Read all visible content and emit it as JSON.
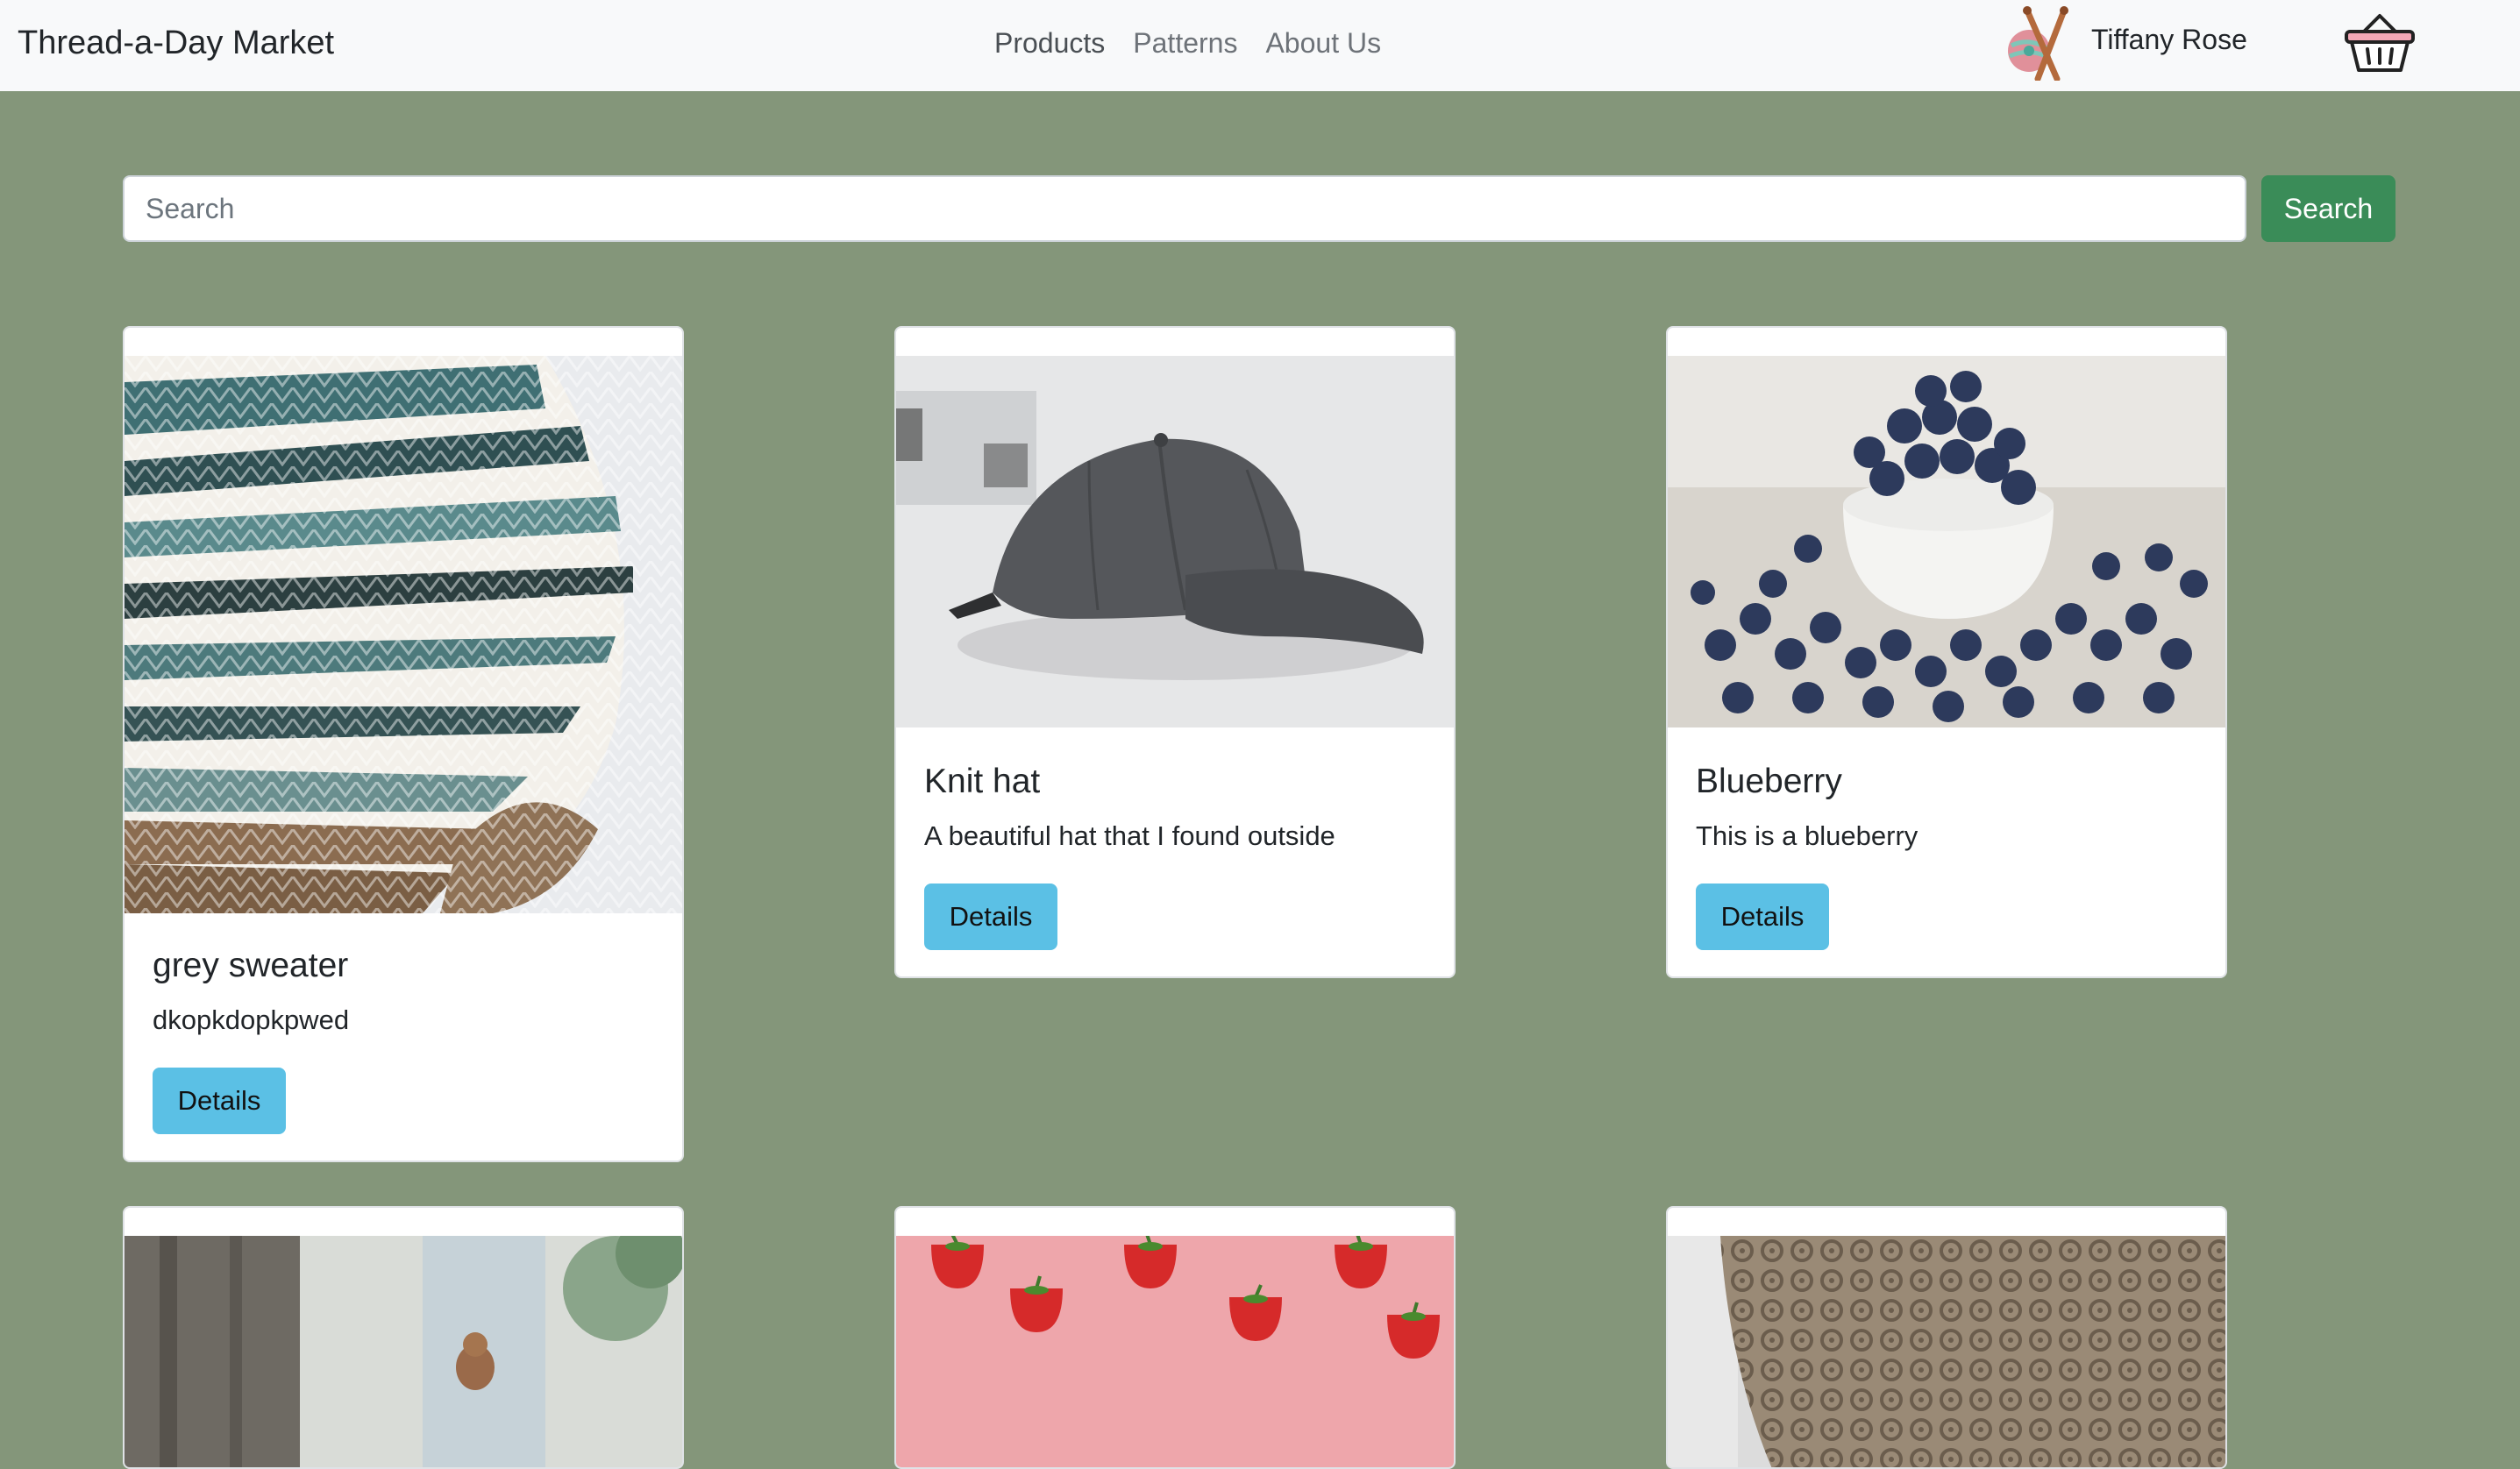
{
  "navbar": {
    "brand": "Thread-a-Day Market",
    "links": [
      "Products",
      "Patterns",
      "About Us"
    ],
    "user_name": "Tiffany Rose",
    "avatar_icon": "yarn-needles-icon",
    "cart_icon": "basket-icon"
  },
  "search": {
    "placeholder": "Search",
    "button_label": "Search"
  },
  "products": [
    {
      "title": "grey sweater",
      "description": "dkopkdopkpwed",
      "button": "Details",
      "image": "knit-sweater-photo"
    },
    {
      "title": "Knit hat",
      "description": "A beautiful hat that I found outside",
      "button": "Details",
      "image": "cap-photo"
    },
    {
      "title": "Blueberry",
      "description": "This is a blueberry",
      "button": "Details",
      "image": "blueberry-bowl-photo"
    }
  ],
  "partial_products": [
    {
      "image": "squirrel-photo"
    },
    {
      "image": "strawberries-photo"
    },
    {
      "image": "crochet-doily-photo"
    }
  ],
  "colors": {
    "page_background": "#84967a",
    "navbar_background": "#f8f9fa",
    "search_button": "#3a8c58",
    "details_button": "#5bc0e5"
  }
}
